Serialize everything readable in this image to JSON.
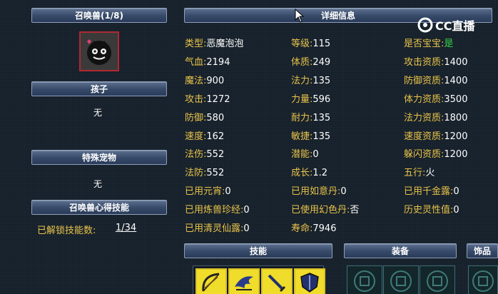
{
  "left_panel": {
    "pet_header": "召唤兽(1/8)",
    "children_header": "孩子",
    "children_value": "无",
    "special_header": "特殊宠物",
    "special_value": "无",
    "skill_header": "召唤兽心得技能",
    "unlock_label": "已解锁技能数:",
    "unlock_value": "1/34"
  },
  "detail": {
    "header": "详细信息",
    "col1": [
      {
        "label": "类型:",
        "value": "恶魔泡泡"
      },
      {
        "label": "气血:",
        "value": "2194"
      },
      {
        "label": "魔法:",
        "value": "900"
      },
      {
        "label": "攻击:",
        "value": "1272"
      },
      {
        "label": "防御:",
        "value": "580"
      },
      {
        "label": "速度:",
        "value": "162"
      },
      {
        "label": "法伤:",
        "value": "552"
      },
      {
        "label": "法防:",
        "value": "552"
      },
      {
        "label": "已用元宵:",
        "value": "0"
      },
      {
        "label": "已用炼兽珍经:",
        "value": "0"
      },
      {
        "label": "已用清灵仙露:",
        "value": "0"
      }
    ],
    "col2": [
      {
        "label": "等级:",
        "value": "115"
      },
      {
        "label": "体质:",
        "value": "249"
      },
      {
        "label": "法力:",
        "value": "135"
      },
      {
        "label": "力量:",
        "value": "596"
      },
      {
        "label": "耐力:",
        "value": "135"
      },
      {
        "label": "敏捷:",
        "value": "135"
      },
      {
        "label": "潜能:",
        "value": "0"
      },
      {
        "label": "成长:",
        "value": "1.2"
      },
      {
        "label": "已用如意丹:",
        "value": "0"
      },
      {
        "label": "已使用幻色丹:",
        "value": "否"
      },
      {
        "label": "寿命:",
        "value": "7946"
      }
    ],
    "col3": [
      {
        "label": "是否宝宝:",
        "value": "是"
      },
      {
        "label": "攻击资质:",
        "value": "1400"
      },
      {
        "label": "防御资质:",
        "value": "1400"
      },
      {
        "label": "体力资质:",
        "value": "3500"
      },
      {
        "label": "法力资质:",
        "value": "1800"
      },
      {
        "label": "速度资质:",
        "value": "1200"
      },
      {
        "label": "躲闪资质:",
        "value": "1200"
      },
      {
        "label": "五行:",
        "value": "火"
      },
      {
        "label": "已用千金露:",
        "value": "0"
      },
      {
        "label": "历史灵性值:",
        "value": "0"
      }
    ]
  },
  "bottom": {
    "skills_header": "技能",
    "equip_header": "装备",
    "accessory_header": "饰品"
  },
  "watermark": {
    "text": "CC直播"
  },
  "colors": {
    "label": "#e8c34a",
    "value": "#ffffff",
    "yes": "#35d64a",
    "header_bg": "#364968",
    "avatar_border": "#b02830",
    "skill_slot": "#f0dc2a"
  },
  "icons": [
    "pet-avatar-icon",
    "bow-skill-icon",
    "wing-skill-icon",
    "sword-skill-icon",
    "shield-skill-icon",
    "equip-coin-icon",
    "cursor-icon",
    "cc-logo-icon"
  ]
}
